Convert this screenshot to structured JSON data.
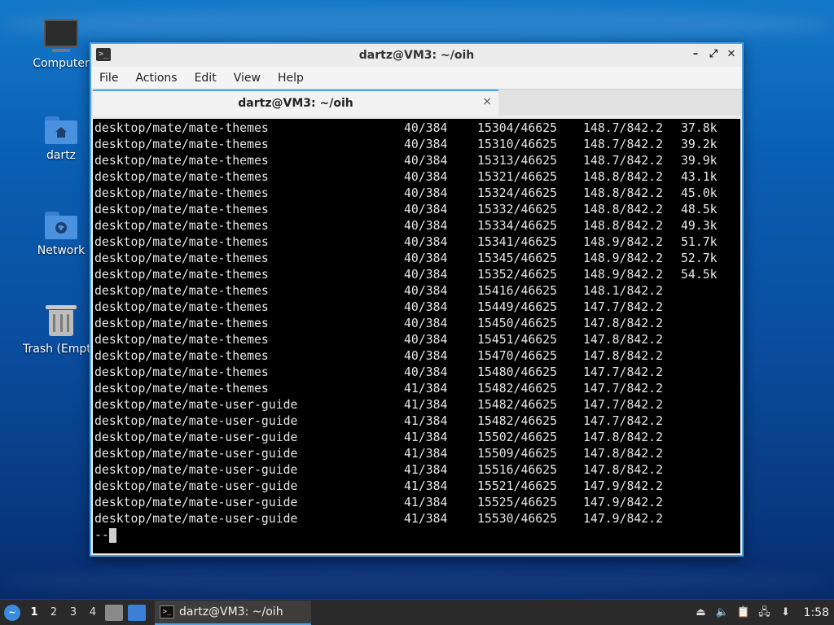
{
  "desktop": {
    "icons": [
      {
        "label": "Computer",
        "icon": "computer-icon"
      },
      {
        "label": "dartz",
        "icon": "home-folder-icon"
      },
      {
        "label": "Network",
        "icon": "network-folder-icon"
      },
      {
        "label": "Trash (Empty)",
        "icon": "trash-icon"
      }
    ]
  },
  "window": {
    "title": "dartz@VM3: ~/oih",
    "controls": {
      "minimize": "–",
      "maximize": "⤢",
      "close": "✕"
    },
    "menu": [
      "File",
      "Actions",
      "Edit",
      "View",
      "Help"
    ],
    "tab": {
      "title": "dartz@VM3: ~/oih",
      "close": "×"
    },
    "terminal": {
      "rows": [
        [
          "desktop/mate/mate-themes",
          "40/384",
          "15304/46625",
          "148.7/842.2",
          "37.8k"
        ],
        [
          "desktop/mate/mate-themes",
          "40/384",
          "15310/46625",
          "148.7/842.2",
          "39.2k"
        ],
        [
          "desktop/mate/mate-themes",
          "40/384",
          "15313/46625",
          "148.7/842.2",
          "39.9k"
        ],
        [
          "desktop/mate/mate-themes",
          "40/384",
          "15321/46625",
          "148.8/842.2",
          "43.1k"
        ],
        [
          "desktop/mate/mate-themes",
          "40/384",
          "15324/46625",
          "148.8/842.2",
          "45.0k"
        ],
        [
          "desktop/mate/mate-themes",
          "40/384",
          "15332/46625",
          "148.8/842.2",
          "48.5k"
        ],
        [
          "desktop/mate/mate-themes",
          "40/384",
          "15334/46625",
          "148.8/842.2",
          "49.3k"
        ],
        [
          "desktop/mate/mate-themes",
          "40/384",
          "15341/46625",
          "148.9/842.2",
          "51.7k"
        ],
        [
          "desktop/mate/mate-themes",
          "40/384",
          "15345/46625",
          "148.9/842.2",
          "52.7k"
        ],
        [
          "desktop/mate/mate-themes",
          "40/384",
          "15352/46625",
          "148.9/842.2",
          "54.5k"
        ],
        [
          "desktop/mate/mate-themes",
          "40/384",
          "15416/46625",
          "148.1/842.2",
          ""
        ],
        [
          "desktop/mate/mate-themes",
          "40/384",
          "15449/46625",
          "147.7/842.2",
          ""
        ],
        [
          "desktop/mate/mate-themes",
          "40/384",
          "15450/46625",
          "147.8/842.2",
          ""
        ],
        [
          "desktop/mate/mate-themes",
          "40/384",
          "15451/46625",
          "147.8/842.2",
          ""
        ],
        [
          "desktop/mate/mate-themes",
          "40/384",
          "15470/46625",
          "147.8/842.2",
          ""
        ],
        [
          "desktop/mate/mate-themes",
          "40/384",
          "15480/46625",
          "147.7/842.2",
          ""
        ],
        [
          "desktop/mate/mate-themes",
          "41/384",
          "15482/46625",
          "147.7/842.2",
          ""
        ],
        [
          "desktop/mate/mate-user-guide",
          "41/384",
          "15482/46625",
          "147.7/842.2",
          ""
        ],
        [
          "desktop/mate/mate-user-guide",
          "41/384",
          "15482/46625",
          "147.7/842.2",
          ""
        ],
        [
          "desktop/mate/mate-user-guide",
          "41/384",
          "15502/46625",
          "147.8/842.2",
          ""
        ],
        [
          "desktop/mate/mate-user-guide",
          "41/384",
          "15509/46625",
          "147.8/842.2",
          ""
        ],
        [
          "desktop/mate/mate-user-guide",
          "41/384",
          "15516/46625",
          "147.8/842.2",
          ""
        ],
        [
          "desktop/mate/mate-user-guide",
          "41/384",
          "15521/46625",
          "147.9/842.2",
          ""
        ],
        [
          "desktop/mate/mate-user-guide",
          "41/384",
          "15525/46625",
          "147.9/842.2",
          ""
        ],
        [
          "desktop/mate/mate-user-guide",
          "41/384",
          "15530/46625",
          "147.9/842.2",
          ""
        ]
      ],
      "prompt": "--"
    }
  },
  "taskbar": {
    "workspaces": [
      "1",
      "2",
      "3",
      "4"
    ],
    "active_workspace": "1",
    "task_label": "dartz@VM3: ~/oih",
    "clock": "1:58",
    "tray_icons": [
      "eject-icon",
      "volume-icon",
      "clipboard-icon",
      "network-icon",
      "updates-icon"
    ]
  }
}
